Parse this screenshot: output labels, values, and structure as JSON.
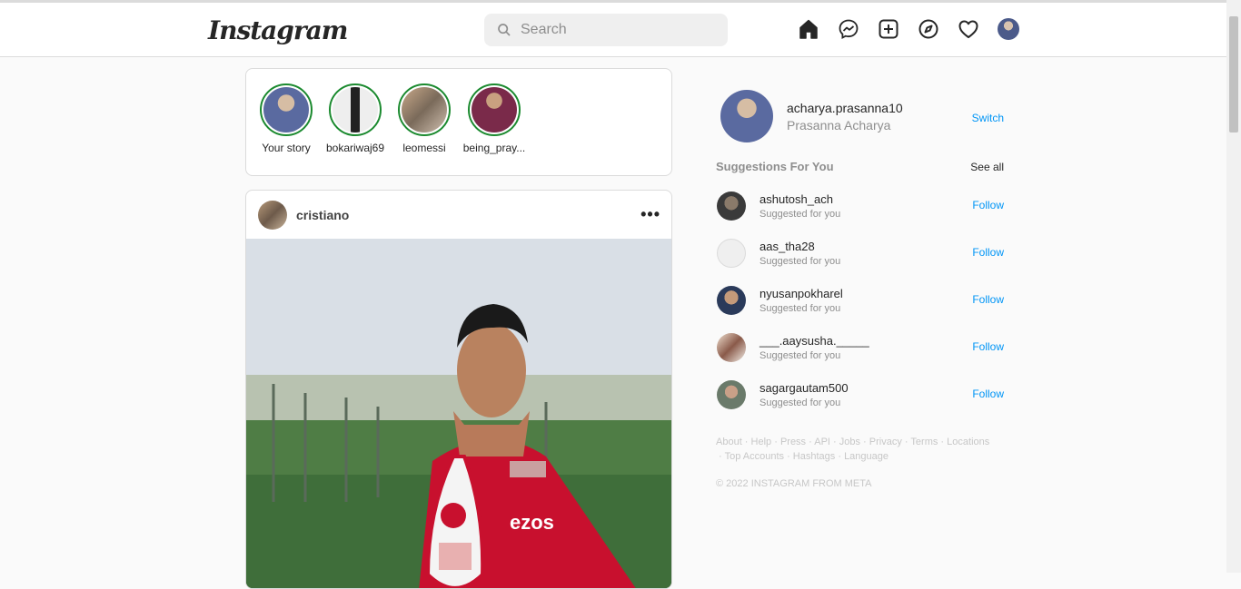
{
  "header": {
    "logo": "Instagram",
    "search_placeholder": "Search"
  },
  "stories": [
    {
      "name": "Your story"
    },
    {
      "name": "bokariwaj69"
    },
    {
      "name": "leomessi"
    },
    {
      "name": "being_pray..."
    }
  ],
  "post": {
    "username": "cristiano",
    "more": "•••"
  },
  "profile": {
    "username": "acharya.prasanna10",
    "fullname": "Prasanna Acharya",
    "switch_label": "Switch"
  },
  "suggestions": {
    "title": "Suggestions For You",
    "see_all": "See all",
    "follow_label": "Follow",
    "items": [
      {
        "username": "ashutosh_ach",
        "sub": "Suggested for you"
      },
      {
        "username": "aas_tha28",
        "sub": "Suggested for you"
      },
      {
        "username": "nyusanpokharel",
        "sub": "Suggested for you"
      },
      {
        "username": "___.aaysusha._____",
        "sub": "Suggested for you"
      },
      {
        "username": "sagargautam500",
        "sub": "Suggested for you"
      }
    ]
  },
  "footer": {
    "links": [
      "About",
      "Help",
      "Press",
      "API",
      "Jobs",
      "Privacy",
      "Terms",
      "Locations",
      "Top Accounts",
      "Hashtags",
      "Language"
    ],
    "copyright": "© 2022 INSTAGRAM FROM META"
  }
}
